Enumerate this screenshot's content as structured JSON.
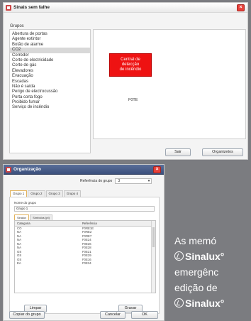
{
  "window1": {
    "title": "Sinais sem falhe",
    "group_label": "Grupos",
    "groups": [
      "Abertura de portas",
      "Agente extintor",
      "Botão de alarme",
      "CO2",
      "Corredor",
      "Corte de electricidade",
      "Corte de gás",
      "Elevadores",
      "Evacuação",
      "Escadas",
      "Não é saída",
      "Perigo de electrocussão",
      "Porta corta fogo",
      "Proibido fumar",
      "Serviço de incêndio"
    ],
    "selected_index": 3,
    "sign_text": [
      "Central de",
      "detecção",
      "de incêndio"
    ],
    "code_label": "F0TE",
    "exit_button": "Sair",
    "organize_button": "Organizetos"
  },
  "window2": {
    "title": "Organização",
    "reference_label": "Referência do grupo",
    "reference_value": "3",
    "tabs": [
      "Grupo 1",
      "Grupo 2",
      "Grupo 3",
      "Grupo 4"
    ],
    "field_label": "Nome do grupo",
    "field_value": "Grupo 1",
    "subtabs": [
      "Sinalux",
      "Símbolos (pt)"
    ],
    "table": {
      "headers": [
        "Categoria",
        "Referência"
      ],
      "rows": [
        [
          "CO",
          "F0RE1E"
        ],
        [
          "NA",
          "F0RE2"
        ],
        [
          "NA",
          "F0RE7"
        ],
        [
          "NA",
          "F0E24"
        ],
        [
          "NA",
          "F0E26"
        ],
        [
          "NA",
          "F0E28"
        ],
        [
          "OS",
          "F0E21"
        ],
        [
          "OS",
          "F0E29"
        ],
        [
          "OS",
          "F0E16"
        ],
        [
          "EA",
          "F0E34"
        ]
      ]
    },
    "clear_button": "Limpar",
    "save_button": "Gravar",
    "load_profile_button": "Copiar do grupo",
    "cancel_button": "Cancelar",
    "ok_button": "OK"
  },
  "side_text": {
    "line1": "As memó",
    "brand1": "Sinalux",
    "brand1_suffix": "°",
    "line3": "emergênc",
    "line4": "edição de",
    "brand2": "Sinalux",
    "brand2_suffix": "°"
  }
}
